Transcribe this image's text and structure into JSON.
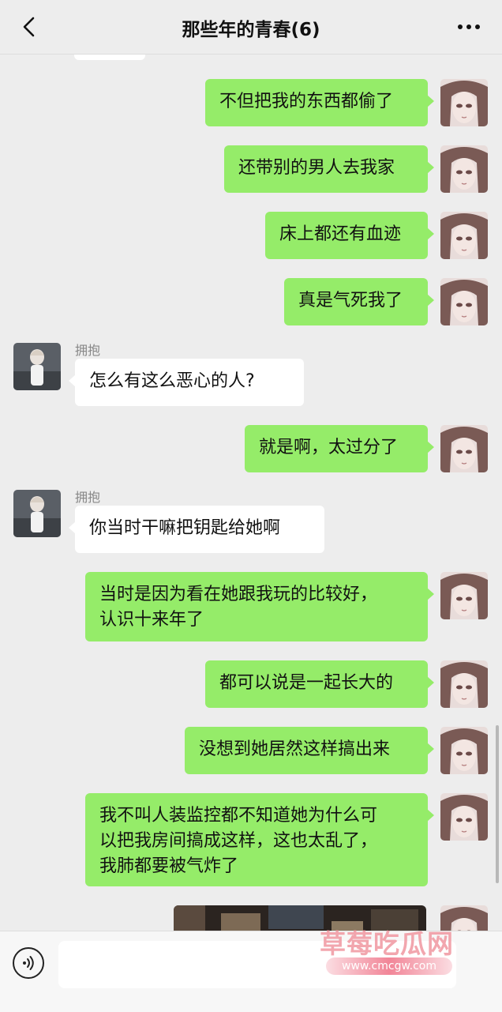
{
  "header": {
    "title": "那些年的青春(6)",
    "back_icon": "chevron-left-icon",
    "more_icon": "more-horizontal-icon"
  },
  "colors": {
    "my_bubble": "#95ec69",
    "other_bubble": "#ffffff",
    "background": "#ededed"
  },
  "messages": [
    {
      "from": "me",
      "text": "不但把我的东西都偷了"
    },
    {
      "from": "me",
      "text": "还带别的男人去我家"
    },
    {
      "from": "me",
      "text": "床上都还有血迹"
    },
    {
      "from": "me",
      "text": "真是气死我了"
    },
    {
      "from": "other",
      "sender": "拥抱",
      "text": "怎么有这么恶心的人?"
    },
    {
      "from": "me",
      "text": "就是啊，太过分了"
    },
    {
      "from": "other",
      "sender": "拥抱",
      "text": "你当时干嘛把钥匙给她啊"
    },
    {
      "from": "me",
      "text": "当时是因为看在她跟我玩的比较好，\n认识十来年了"
    },
    {
      "from": "me",
      "text": "都可以说是一起长大的"
    },
    {
      "from": "me",
      "text": "没想到她居然这样搞出来"
    },
    {
      "from": "me",
      "text": "我不叫人装监控都不知道她为什么可\n以把我房间搞成这样，这也太乱了，\n我肺都要被气炸了"
    }
  ],
  "input_bar": {
    "voice_icon": "voice-input-icon",
    "text_value": ""
  },
  "watermark": {
    "name": "草莓吃瓜网",
    "url": "www.cmcgw.com"
  }
}
